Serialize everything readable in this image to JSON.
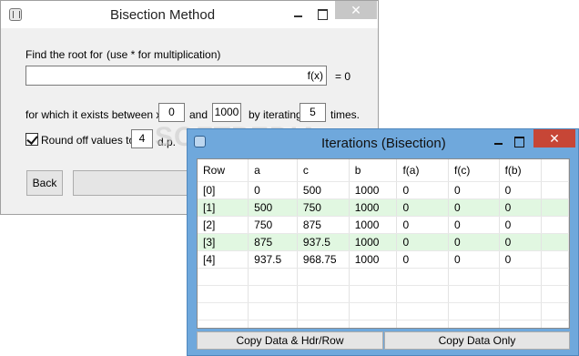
{
  "main_window": {
    "title": "Bisection Method",
    "close_glyph": "✕",
    "find_label": "Find the root for",
    "hint_label": "(use * for multiplication)",
    "fx_label": "f(x)",
    "equals_label": "= 0",
    "exists_label": "for which it exists between x =",
    "x_low": "0",
    "and_label": "and",
    "x_high": "1000",
    "iterating_label": "by iterating",
    "iterations": "5",
    "times_label": "times.",
    "round_label": "Round off values to",
    "round_checked": true,
    "decimals": "4",
    "dp_label": "d.p.",
    "back_label": "Back"
  },
  "watermark": "SOFTPEDIA",
  "iterations_window": {
    "title": "Iterations (Bisection)",
    "close_glyph": "✕",
    "columns": [
      "Row",
      "a",
      "c",
      "b",
      "f(a)",
      "f(c)",
      "f(b)"
    ],
    "rows": [
      [
        "[0]",
        "0",
        "500",
        "1000",
        "0",
        "0",
        "0"
      ],
      [
        "[1]",
        "500",
        "750",
        "1000",
        "0",
        "0",
        "0"
      ],
      [
        "[2]",
        "750",
        "875",
        "1000",
        "0",
        "0",
        "0"
      ],
      [
        "[3]",
        "875",
        "937.5",
        "1000",
        "0",
        "0",
        "0"
      ],
      [
        "[4]",
        "937.5",
        "968.75",
        "1000",
        "0",
        "0",
        "0"
      ]
    ],
    "copy_hdr_label": "Copy Data & Hdr/Row",
    "copy_only_label": "Copy Data Only"
  },
  "colors": {
    "accent": "#6fa8dc",
    "close_active": "#c74636",
    "alt_row": "#e1f7e1"
  }
}
